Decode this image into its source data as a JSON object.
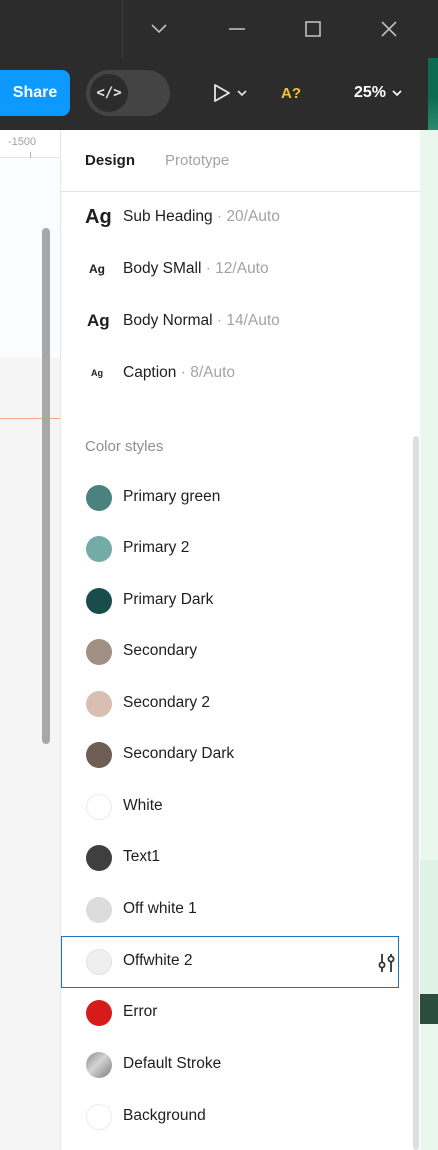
{
  "window": {
    "controls": [
      "chevron-down",
      "minimize",
      "maximize",
      "close"
    ]
  },
  "toolbar": {
    "share_label": "Share",
    "dev_mode_icon": "</>",
    "text_check_label": "A?",
    "zoom_label": "25%"
  },
  "canvas": {
    "ruler_label": "-1500"
  },
  "panel": {
    "tabs": [
      {
        "label": "Design"
      },
      {
        "label": "Prototype"
      }
    ],
    "text_styles": [
      {
        "icon": "Ag",
        "name": "Sub Heading",
        "meta": " · 20/Auto"
      },
      {
        "icon": "Ag",
        "name": "Body SMall",
        "meta": " · 12/Auto"
      },
      {
        "icon": "Ag",
        "name": "Body Normal",
        "meta": " · 14/Auto"
      },
      {
        "icon": "Ag",
        "name": "Caption",
        "meta": " · 8/Auto"
      }
    ],
    "color_section_title": "Color styles",
    "color_styles": [
      {
        "name": "Primary green",
        "color": "#4a8280"
      },
      {
        "name": "Primary 2",
        "color": "#74aba7"
      },
      {
        "name": "Primary Dark",
        "color": "#184d4b"
      },
      {
        "name": "Secondary",
        "color": "#a08f84"
      },
      {
        "name": "Secondary 2",
        "color": "#d8bfb2"
      },
      {
        "name": "Secondary Dark",
        "color": "#6e5e54"
      },
      {
        "name": "White",
        "color": "#ffffff"
      },
      {
        "name": "Text1",
        "color": "#3f3f3f"
      },
      {
        "name": "Off white 1",
        "color": "#dcdcdc"
      },
      {
        "name": "Offwhite 2",
        "color": "#efefef"
      },
      {
        "name": "Error",
        "color": "#d71a1a"
      },
      {
        "name": "Default Stroke",
        "color": "#a6a6a6"
      },
      {
        "name": "Background",
        "color": "#ffffff"
      }
    ]
  },
  "colors": {
    "accent": "#0d99ff",
    "selection": "#1e73be"
  }
}
